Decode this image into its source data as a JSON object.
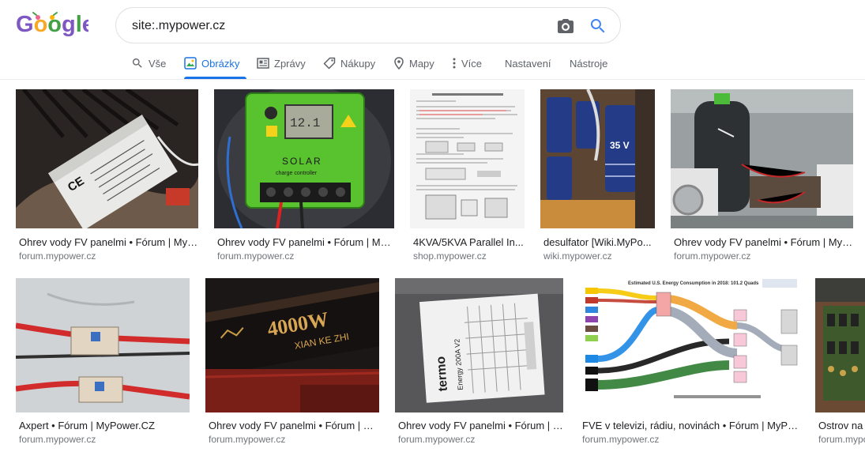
{
  "logo_text": "Google",
  "search": {
    "query": "site:.mypower.cz"
  },
  "tabs": [
    {
      "label": "Vše",
      "icon": "search-icon"
    },
    {
      "label": "Obrázky",
      "icon": "image-icon",
      "active": true
    },
    {
      "label": "Zprávy",
      "icon": "news-icon"
    },
    {
      "label": "Nákupy",
      "icon": "tag-icon"
    },
    {
      "label": "Mapy",
      "icon": "pin-icon"
    },
    {
      "label": "Více",
      "icon": "more-vert-icon"
    },
    {
      "label": "Nastavení"
    },
    {
      "label": "Nástroje"
    }
  ],
  "results": [
    {
      "title": "Ohrev vody FV panelmi • Fórum | MyPo...",
      "domain": "forum.mypower.cz",
      "thumb": "charge-controller-label"
    },
    {
      "title": "Ohrev vody FV panelmi • Fórum | MyP...",
      "domain": "forum.mypower.cz",
      "thumb": "solar-charge-controller"
    },
    {
      "title": "4KVA/5KVA Parallel In...",
      "domain": "shop.mypower.cz",
      "thumb": "installation-guide-document"
    },
    {
      "title": "desulfator [Wiki.MyPo...",
      "domain": "wiki.mypower.cz",
      "thumb": "capacitors"
    },
    {
      "title": "Ohrev vody FV panelmi • Fórum | MyPo...",
      "domain": "forum.mypower.cz",
      "thumb": "water-heater-room"
    },
    {
      "title": "Axpert • Fórum | MyPower.CZ",
      "domain": "forum.mypower.cz",
      "thumb": "cables-breakers"
    },
    {
      "title": "Ohrev vody FV panelmi • Fórum | My...",
      "domain": "forum.mypower.cz",
      "thumb": "power-inverter-4000w"
    },
    {
      "title": "Ohrev vody FV panelmi • Fórum | M...",
      "domain": "forum.mypower.cz",
      "thumb": "energy-label"
    },
    {
      "title": "FVE v televizi, rádiu, novinách • Fórum | MyPo...",
      "domain": "forum.mypower.cz",
      "thumb": "energy-flow-chart"
    },
    {
      "title": "Ostrov na l",
      "domain": "forum.mypo",
      "thumb": "circuit-board"
    }
  ],
  "thumb_text": {
    "ce_mark": "CE",
    "solar_word": "SOLAR",
    "solar_sub": "charge controller",
    "lcd": "12.1",
    "inverter_watts": "4000W",
    "inverter_brand": "XIAN KE ZHI",
    "label_brand": "termo",
    "label_model": "Energy 200A V2",
    "chart_title": "Estimated U.S. Energy Consumption in 2018: 101.2 Quads",
    "cap_text": "35 V"
  }
}
